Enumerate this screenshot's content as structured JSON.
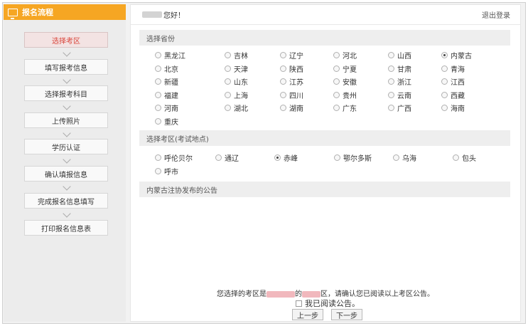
{
  "sidebar": {
    "title": "报名流程",
    "steps": [
      "选择考区",
      "填写报考信息",
      "选择报考科目",
      "上传照片",
      "学历认证",
      "确认填报信息",
      "完成报名信息填写",
      "打印报名信息表"
    ]
  },
  "topbar": {
    "greeting_suffix": "您好！",
    "logout": "退出登录"
  },
  "province": {
    "header": "选择省份",
    "selected": "内蒙古",
    "rows": [
      [
        "黑龙江",
        "吉林",
        "辽宁",
        "河北",
        "山西",
        "内蒙古"
      ],
      [
        "北京",
        "天津",
        "陕西",
        "宁夏",
        "甘肃",
        "青海"
      ],
      [
        "新疆",
        "山东",
        "江苏",
        "安徽",
        "浙江",
        "江西"
      ],
      [
        "福建",
        "上海",
        "四川",
        "贵州",
        "云南",
        "西藏"
      ],
      [
        "河南",
        "湖北",
        "湖南",
        "广东",
        "广西",
        "海南"
      ],
      [
        "重庆"
      ]
    ]
  },
  "area": {
    "header": "选择考区(考试地点)",
    "selected": "赤峰",
    "rows": [
      [
        "呼伦贝尔",
        "通辽",
        "赤峰",
        "鄂尔多斯",
        "乌海",
        "包头"
      ],
      [
        "呼市"
      ]
    ]
  },
  "announcement": {
    "header": "内蒙古注协发布的公告"
  },
  "footer": {
    "text_prefix": "您选择的考区是",
    "text_middle": "的",
    "text_suffix": "区，请确认您已阅读以上考区公告。",
    "agree_label": "我已阅读公告。",
    "prev_button": "上一步",
    "next_button": "下一步"
  }
}
